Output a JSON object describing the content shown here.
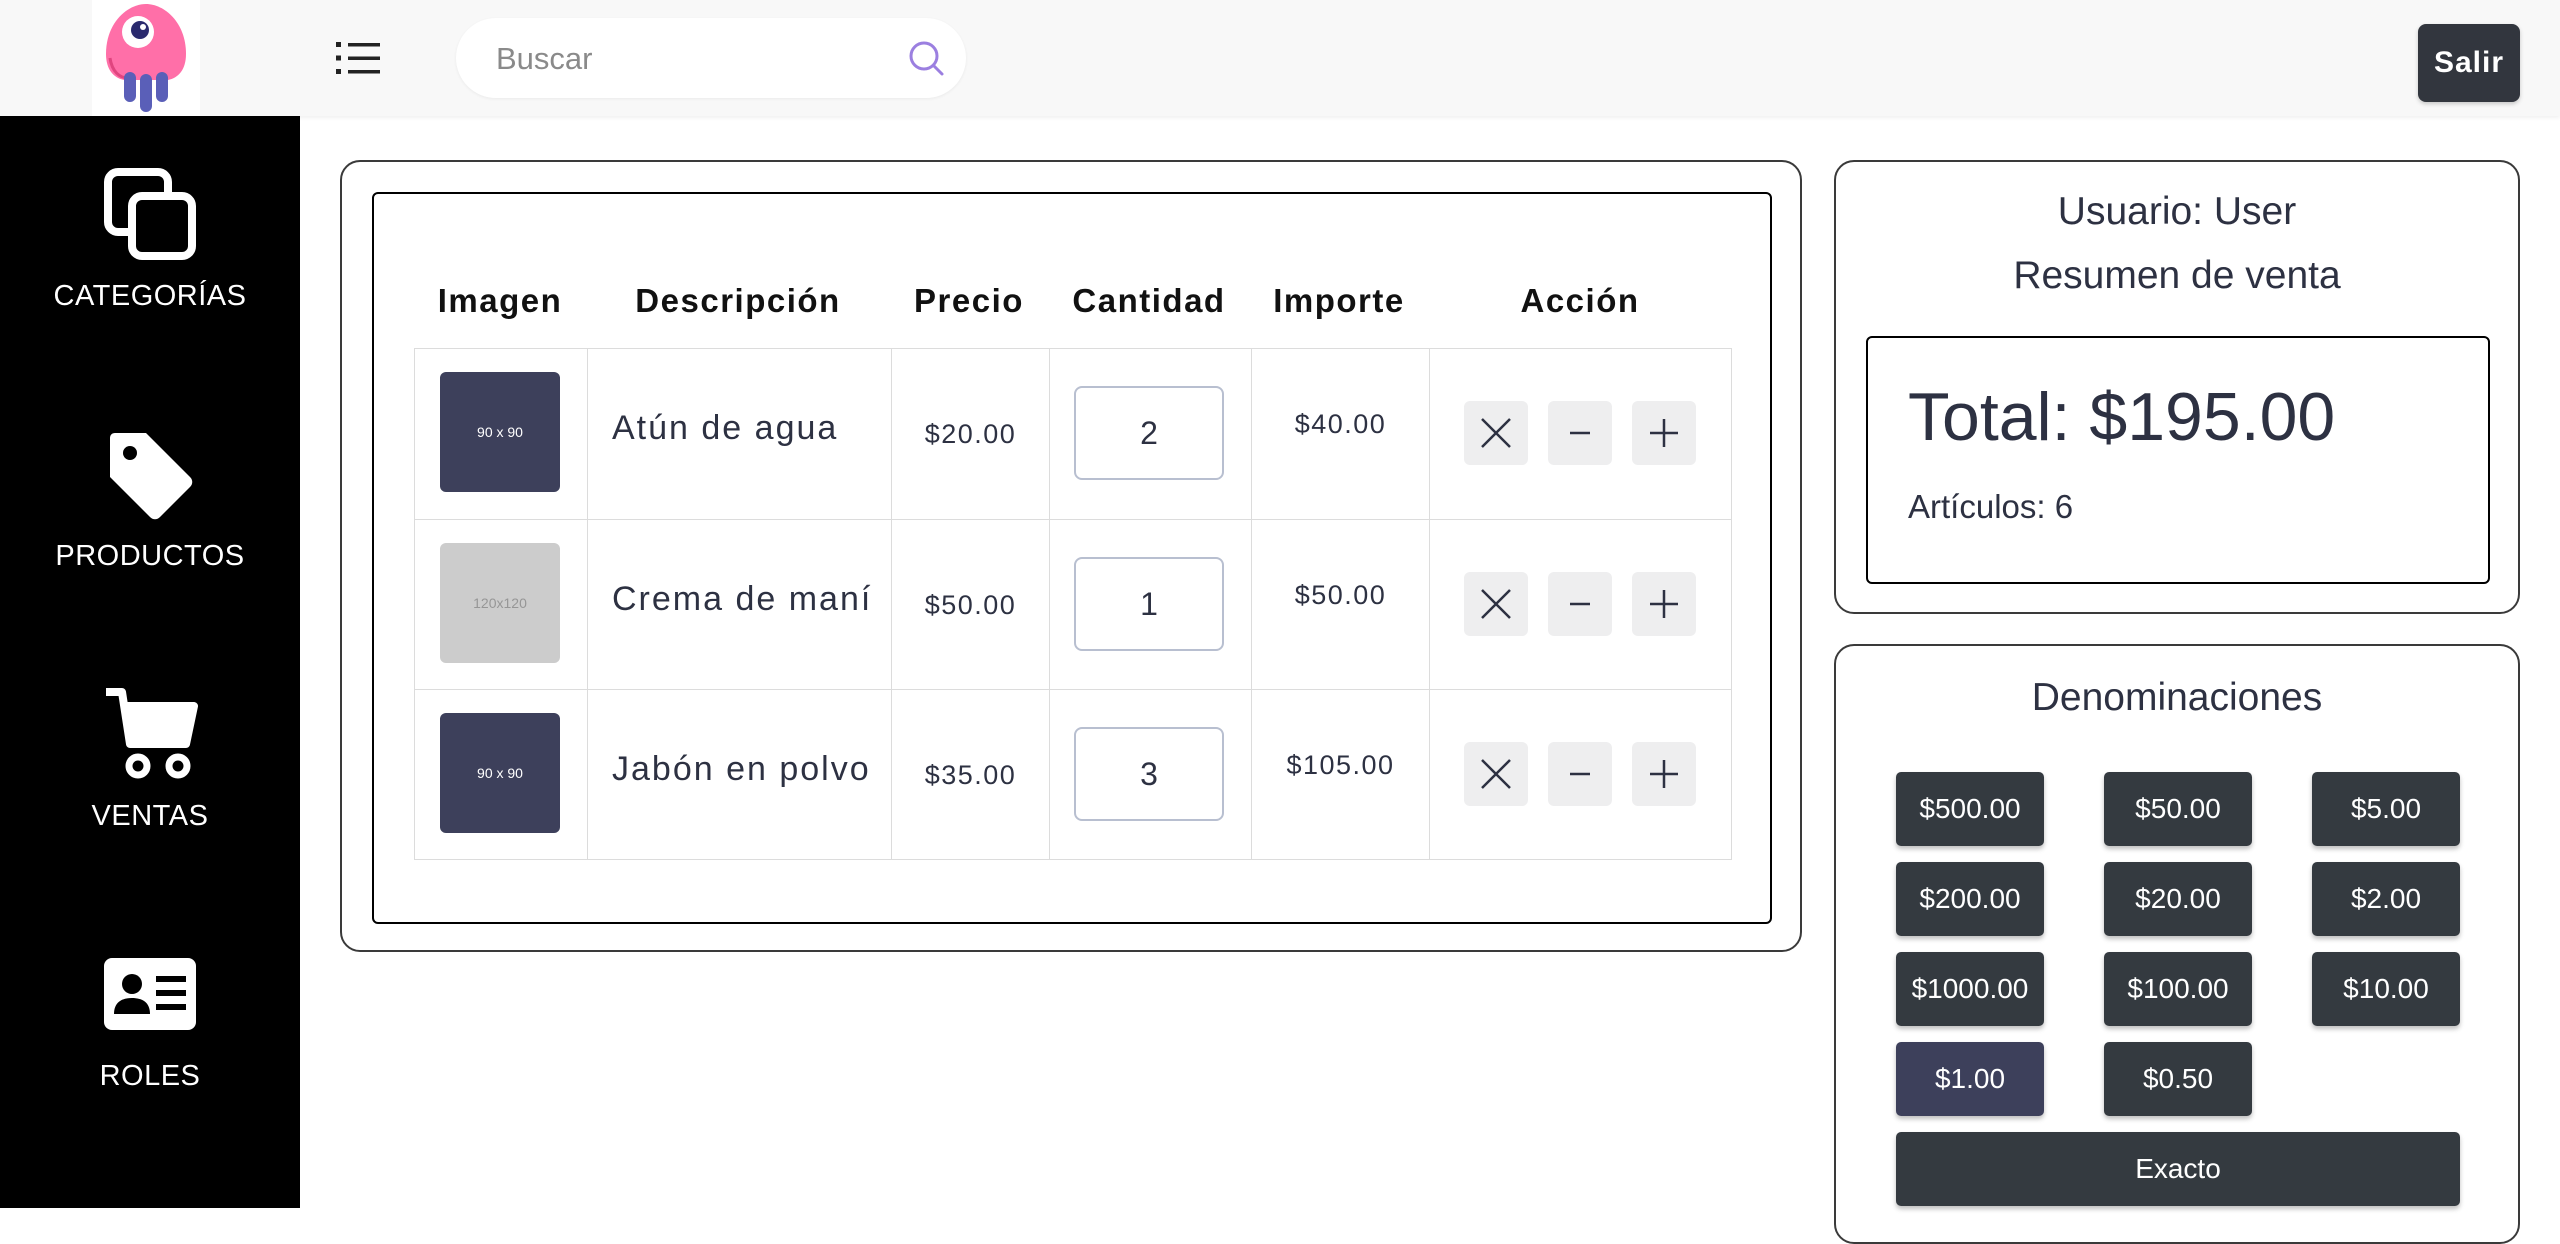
{
  "header": {
    "search_placeholder": "Buscar",
    "logout_label": "Salir"
  },
  "sidebar": {
    "items": [
      {
        "label": "CATEGORÍAS",
        "icon": "layers-icon"
      },
      {
        "label": "PRODUCTOS",
        "icon": "tag-icon"
      },
      {
        "label": "VENTAS",
        "icon": "cart-icon"
      },
      {
        "label": "ROLES",
        "icon": "id-card-icon"
      }
    ]
  },
  "cart": {
    "columns": [
      "Imagen",
      "Descripción",
      "Precio",
      "Cantidad",
      "Importe",
      "Acción"
    ],
    "rows": [
      {
        "image_label": "90 x 90",
        "description": "Atún de agua",
        "price": "$20.00",
        "quantity": "2",
        "amount": "$40.00"
      },
      {
        "image_label": "120x120",
        "description": "Crema de maní",
        "price": "$50.00",
        "quantity": "1",
        "amount": "$50.00"
      },
      {
        "image_label": "90 x 90",
        "description": "Jabón en polvo",
        "price": "$35.00",
        "quantity": "3",
        "amount": "$105.00"
      }
    ]
  },
  "summary": {
    "user_line": "Usuario: User",
    "title": "Resumen de venta",
    "total": "Total: $195.00",
    "items": "Artículos: 6"
  },
  "denominations": {
    "title": "Denominaciones",
    "buttons": [
      "$500.00",
      "$50.00",
      "$5.00",
      "$200.00",
      "$20.00",
      "$2.00",
      "$1000.00",
      "$100.00",
      "$10.00",
      "$1.00",
      "$0.50"
    ],
    "selected": "$1.00",
    "exact_label": "Exacto"
  },
  "colors": {
    "sidebar_bg": "#000000",
    "primary_dark": "#343a40",
    "accent": "#3d405b",
    "text": "#2d3142",
    "logo_pink": "#ff6fa8",
    "search_icon": "#9b7fe0"
  }
}
